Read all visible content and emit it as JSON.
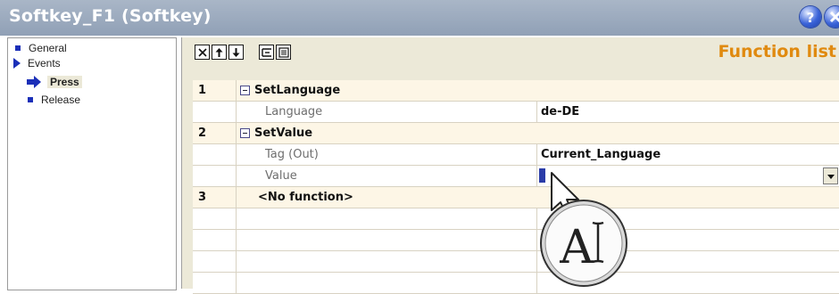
{
  "window": {
    "title": "Softkey_F1 (Softkey)"
  },
  "tree": {
    "items": [
      {
        "label": "General"
      },
      {
        "label": "Events"
      },
      {
        "label": "Press"
      },
      {
        "label": "Release"
      }
    ]
  },
  "toolbar": {
    "icons": [
      "delete-icon",
      "move-up-icon",
      "move-down-icon",
      "indent-icon",
      "list-icon"
    ]
  },
  "panel": {
    "title": "Function list"
  },
  "functions": {
    "row1": {
      "num": "1",
      "name": "SetLanguage",
      "param_name": "Language",
      "param_value": "de-DE"
    },
    "row2": {
      "num": "2",
      "name": "SetValue",
      "param1_name": "Tag (Out)",
      "param1_value": "Current_Language",
      "param2_name": "Value",
      "param2_value": ""
    },
    "row3": {
      "num": "3",
      "name": "<No function>"
    }
  },
  "cursor": {
    "glyph": "A"
  }
}
